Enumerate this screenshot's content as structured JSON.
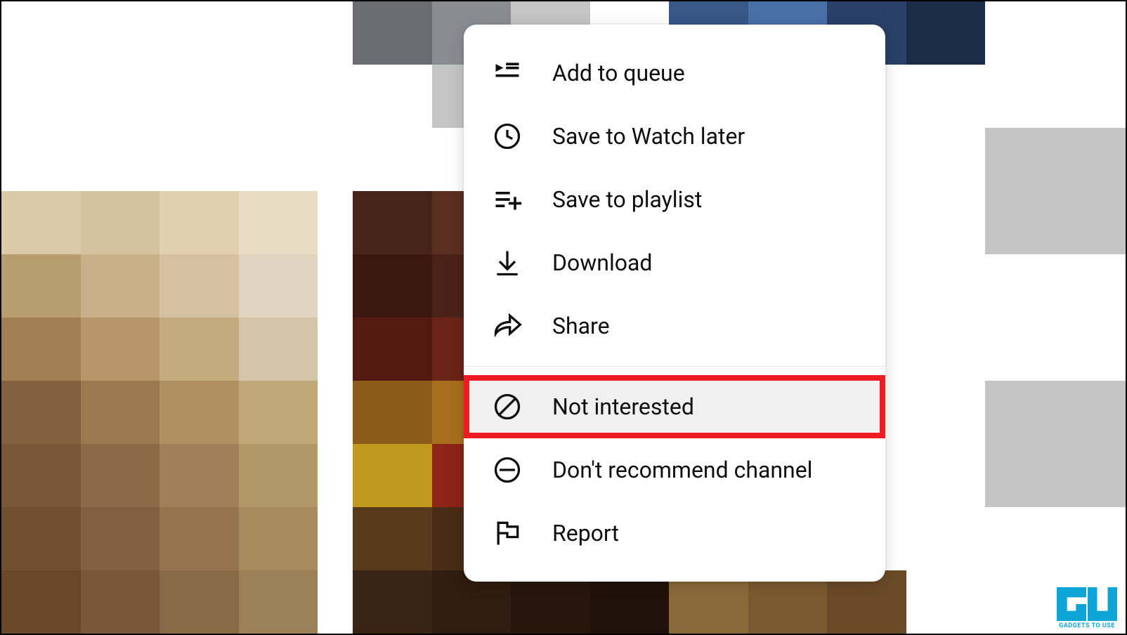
{
  "menu": {
    "items": [
      {
        "icon": "queue",
        "label": "Add to queue"
      },
      {
        "icon": "clock",
        "label": "Save to Watch later"
      },
      {
        "icon": "playlist-add",
        "label": "Save to playlist"
      },
      {
        "icon": "download",
        "label": "Download"
      },
      {
        "icon": "share",
        "label": "Share"
      }
    ],
    "items2": [
      {
        "icon": "not-interested",
        "label": "Not interested",
        "highlighted": true
      },
      {
        "icon": "block-channel",
        "label": "Don't recommend channel"
      },
      {
        "icon": "flag",
        "label": "Report"
      }
    ]
  },
  "watermark": {
    "text": "GADGETS TO USE"
  }
}
